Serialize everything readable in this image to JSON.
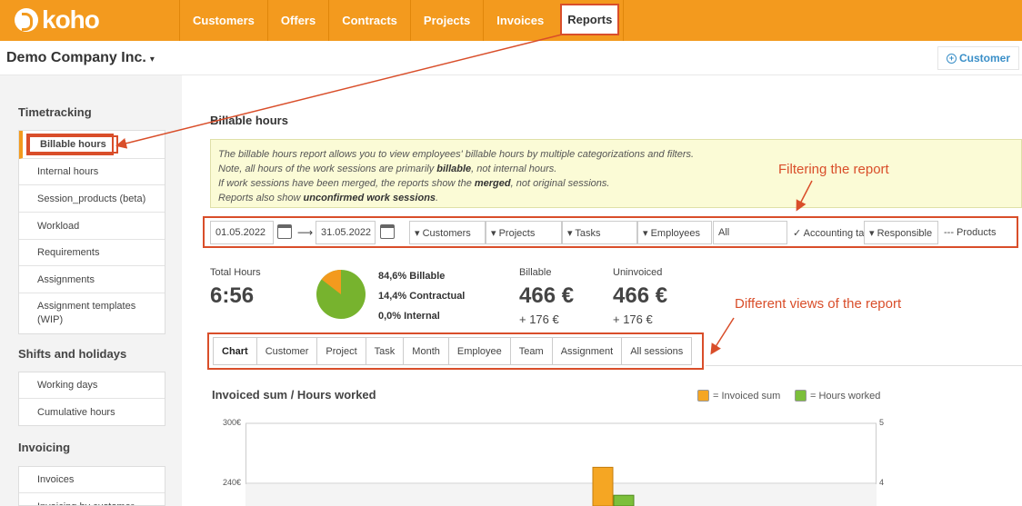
{
  "app": {
    "logo_text": "koho",
    "logo_icon": "koho-logo-icon",
    "accent": "#f39a1e",
    "highlight": "#d94e2a"
  },
  "nav": {
    "items": [
      "Customers",
      "Offers",
      "Contracts",
      "Projects",
      "Invoices",
      "Reports"
    ],
    "active": "Reports"
  },
  "company": {
    "name": "Demo Company Inc.",
    "caret": "▾"
  },
  "customer_button": {
    "icon": "plus-circle-icon",
    "label": "Customer"
  },
  "sidebar": {
    "sections": [
      {
        "heading": "Timetracking",
        "items": [
          "Billable hours",
          "Internal hours",
          "Session_products (beta)",
          "Workload",
          "Requirements",
          "Assignments",
          "Assignment templates (WIP)"
        ]
      },
      {
        "heading": "Shifts and holidays",
        "items": [
          "Working days",
          "Cumulative hours"
        ]
      },
      {
        "heading": "Invoicing",
        "items": [
          "Invoices",
          "Invoicing by customer"
        ]
      }
    ],
    "active": "Billable hours"
  },
  "page": {
    "title": "Billable hours",
    "info": {
      "line1": "The billable hours report allows you to view employees' billable hours by multiple categorizations and filters.",
      "line2_a": "Note, all hours of the work sessions are primarily ",
      "line2_b": "billable",
      "line2_c": ", not internal hours.",
      "line3_a": "If work sessions have been merged, the reports show the ",
      "line3_b": "merged",
      "line3_c": ", not original sessions.",
      "line4_a": "Reports also show ",
      "line4_b": "unconfirmed work sessions",
      "line4_c": "."
    }
  },
  "filters": {
    "date_from": "01.05.2022",
    "date_to": "31.05.2022",
    "arrow": "⟶",
    "customers": "▾ Customers",
    "projects": "▾ Projects",
    "tasks": "▾ Tasks",
    "employees": "▾ Employees",
    "all": "All",
    "accounting": "✓ Accounting target",
    "responsible": "▾ Responsible",
    "products": "--- Products"
  },
  "stats": {
    "total_hours_label": "Total Hours",
    "total_hours": "6:56",
    "billable_pct": "84,6% Billable",
    "contractual_pct": "14,4% Contractual",
    "internal_pct": "0,0% Internal",
    "pie": {
      "billable": 84.6,
      "contractual": 14.4,
      "internal": 0.0,
      "billable_color": "#77b32e",
      "contractual_color": "#f39a1e"
    },
    "billable_label": "Billable",
    "billable_value": "466 €",
    "billable_extra": "+ 176 €",
    "uninvoiced_label": "Uninvoiced",
    "uninvoiced_value": "466 €",
    "uninvoiced_extra": "+ 176 €"
  },
  "tabs": [
    "Chart",
    "Customer",
    "Project",
    "Task",
    "Month",
    "Employee",
    "Team",
    "Assignment",
    "All sessions"
  ],
  "active_tab": "Chart",
  "chart": {
    "title": "Invoiced sum / Hours worked",
    "legend": [
      {
        "label": "= Invoiced sum",
        "color": "#f5a623"
      },
      {
        "label": "= Hours worked",
        "color": "#7cbf3b"
      }
    ],
    "left_ticks": [
      "300€",
      "240€"
    ],
    "right_ticks": [
      "5",
      "4"
    ]
  },
  "chart_data": {
    "type": "bar",
    "title": "Invoiced sum / Hours worked",
    "series": [
      {
        "name": "Invoiced sum",
        "values": [
          256
        ]
      },
      {
        "name": "Hours worked",
        "values": [
          3.8
        ]
      }
    ],
    "ylim_left": [
      0,
      300
    ],
    "ylim_right": [
      0,
      5
    ],
    "left_tick_labels": [
      "300€",
      "240€"
    ],
    "right_tick_labels": [
      "5",
      "4"
    ],
    "legend_position": "top-right"
  },
  "annotations": {
    "filtering": "Filtering the report",
    "views": "Different views of the report"
  }
}
